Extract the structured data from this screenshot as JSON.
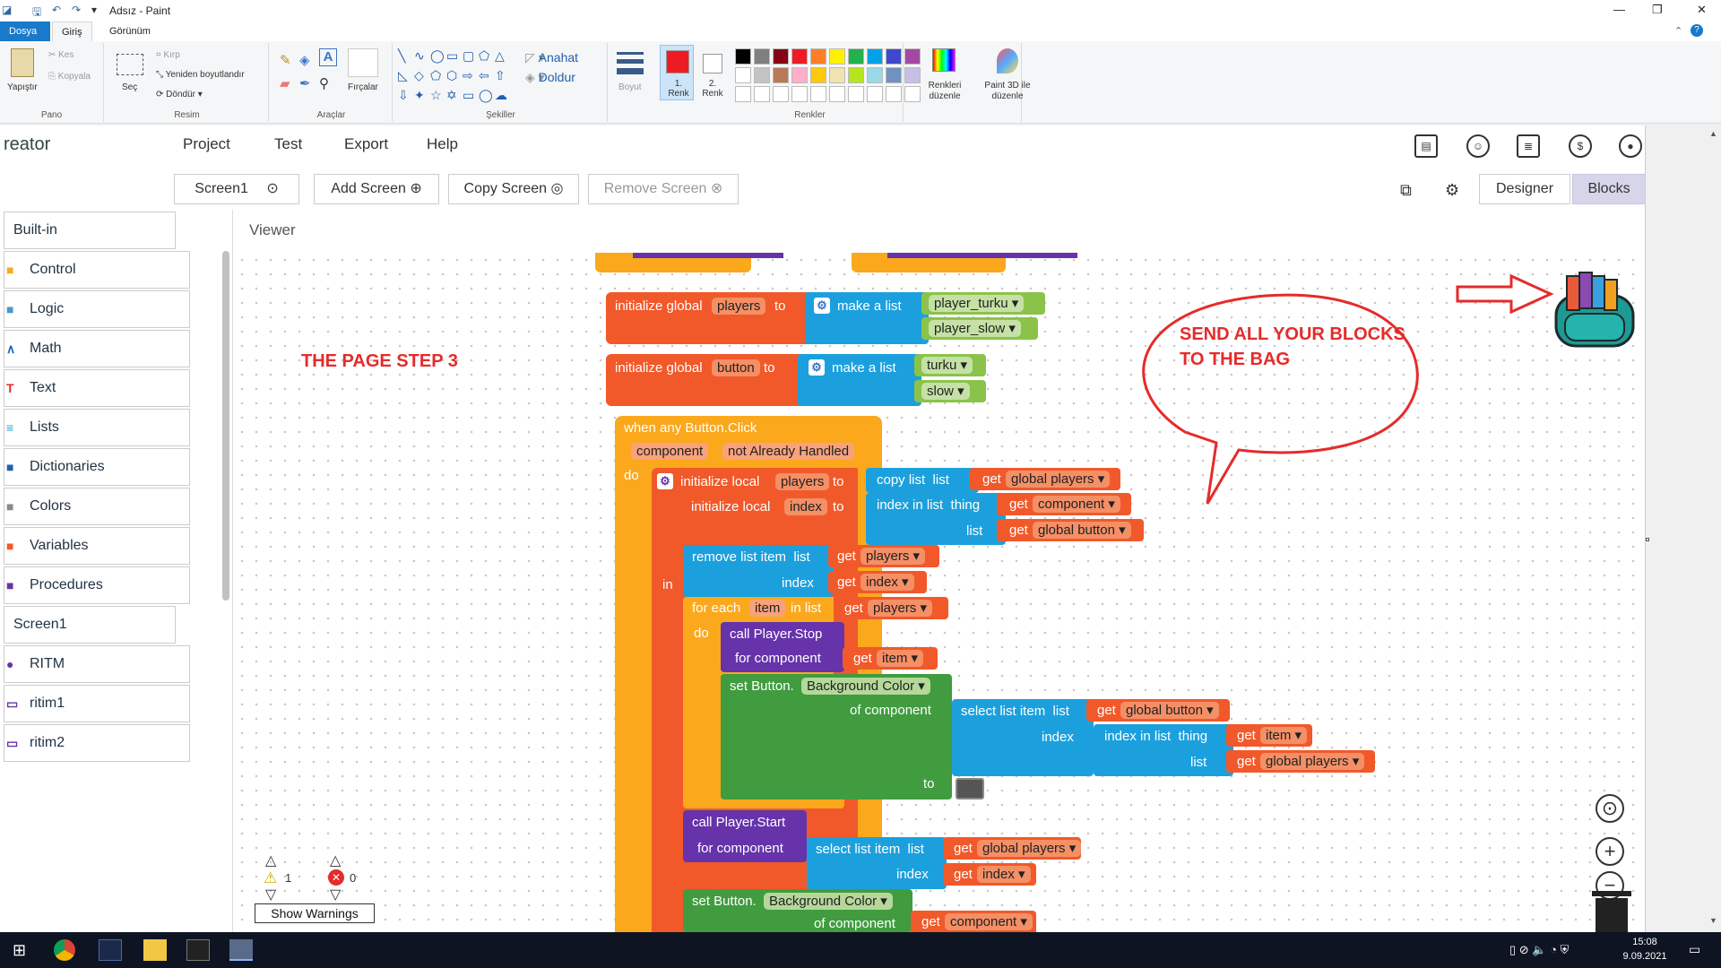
{
  "paint": {
    "title": "Adsız - Paint",
    "tabs": [
      "Dosya",
      "Giriş",
      "Görünüm"
    ],
    "groups": {
      "pano": "Pano",
      "resim": "Resim",
      "araclar": "Araçlar",
      "sekiller": "Şekiller",
      "renkler": "Renkler"
    },
    "buttons": {
      "paste": "Yapıştır",
      "cut": "Kes",
      "copy": "Kopyala",
      "select": "Seç",
      "crop": "Kırp",
      "resize": "Yeniden boyutlandır",
      "rotate": "Döndür",
      "brushes": "Fırçalar",
      "outline": "Anahat",
      "fill": "Doldur",
      "size": "Boyut",
      "color1": "1. Renk",
      "color2": "2. Renk",
      "edit_colors": "Renkleri düzenle",
      "paint3d": "Paint 3D ile düzenle"
    },
    "palette_row1": [
      "#000000",
      "#7f7f7f",
      "#880015",
      "#ed1c24",
      "#ff7f27",
      "#fff200",
      "#22b14c",
      "#00a2e8",
      "#3f48cc",
      "#a349a4"
    ],
    "palette_row2": [
      "#ffffff",
      "#c3c3c3",
      "#b97a57",
      "#ffaec9",
      "#ffc90e",
      "#efe4b0",
      "#b5e61d",
      "#99d9ea",
      "#7092be",
      "#c8bfe7"
    ],
    "color1": "#ed1c24",
    "color2": "#ffffff"
  },
  "app": {
    "brand": "reator",
    "menu": [
      "Project",
      "Test",
      "Export",
      "Help"
    ],
    "toolbar": {
      "screen": "Screen1",
      "add_screen": "Add Screen",
      "copy_screen": "Copy Screen",
      "remove_screen": "Remove Screen",
      "designer": "Designer",
      "blocks": "Blocks"
    },
    "viewer": "Viewer",
    "sidebar": [
      {
        "label": "Built-in",
        "icon": "",
        "color": "#234"
      },
      {
        "label": "Control",
        "icon": "■",
        "color": "#fba81d"
      },
      {
        "label": "Logic",
        "icon": "■",
        "color": "#4c97cc"
      },
      {
        "label": "Math",
        "icon": "∧",
        "color": "#2a6ab6"
      },
      {
        "label": "Text",
        "icon": "T",
        "color": "#e52b2b"
      },
      {
        "label": "Lists",
        "icon": "≡",
        "color": "#1ca0dd"
      },
      {
        "label": "Dictionaries",
        "icon": "■",
        "color": "#2060b0"
      },
      {
        "label": "Colors",
        "icon": "■",
        "color": "#888"
      },
      {
        "label": "Variables",
        "icon": "■",
        "color": "#f1592a"
      },
      {
        "label": "Procedures",
        "icon": "■",
        "color": "#6633aa"
      },
      {
        "label": "Screen1",
        "icon": "",
        "color": "#234"
      },
      {
        "label": "RITM",
        "icon": "●",
        "color": "#6633aa"
      },
      {
        "label": "ritim1",
        "icon": "▭",
        "color": "#6633aa"
      },
      {
        "label": "ritim2",
        "icon": "▭",
        "color": "#6633aa"
      }
    ],
    "notes": {
      "step": "THE PAGE STEP 3",
      "bag_line1": "SEND ALL YOUR BLOCKS",
      "bag_line2": "TO THE BAG"
    },
    "warnings": {
      "warn_count": "1",
      "error_count": "0",
      "show": "Show Warnings"
    },
    "blocks": {
      "init_global": "initialize global",
      "to": "to",
      "make_a_list": "make a list",
      "players": "players",
      "player_turku": "player_turku",
      "player_slow": "player_slow",
      "button": "button",
      "turku": "turku",
      "slow": "slow",
      "when_any": "when any Button.Click",
      "component": "component",
      "not_handled": "not Already Handled",
      "do": "do",
      "init_local": "initialize local",
      "copy_list": "copy list",
      "list": "list",
      "get": "get",
      "global_players": "global players",
      "index": "index",
      "index_in_list": "index in list",
      "thing": "thing",
      "global_button": "global button",
      "in": "in",
      "remove_list_item": "remove list item",
      "for_each": "for each",
      "item": "item",
      "in_list": "in list",
      "call_stop": "call Player.Stop",
      "for_component": "for component",
      "set_button": "set Button.",
      "background_color": "Background Color",
      "of_component": "of component",
      "select_list_item": "select list item",
      "call_start": "call Player.Start"
    }
  },
  "taskbar": {
    "time": "15:08",
    "date": "9.09.2021"
  }
}
